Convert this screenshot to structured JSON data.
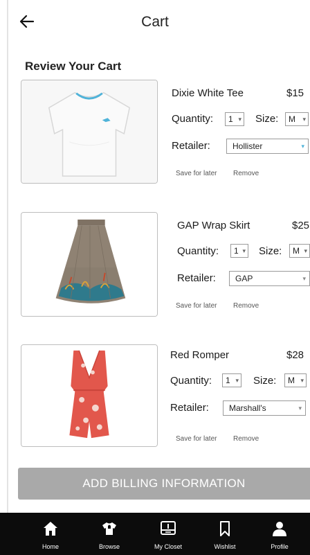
{
  "header": {
    "title": "Cart"
  },
  "section": {
    "heading": "Review Your Cart"
  },
  "items": [
    {
      "name": "Dixie White Tee",
      "price": "$15",
      "quantity_label": "Quantity:",
      "quantity": "1",
      "size_label": "Size:",
      "size": "M",
      "retailer_label": "Retailer:",
      "retailer": "Hollister",
      "save_label": "Save for later",
      "remove_label": "Remove"
    },
    {
      "name": "GAP Wrap Skirt",
      "price": "$25",
      "quantity_label": "Quantity:",
      "quantity": "1",
      "size_label": "Size:",
      "size": "M",
      "retailer_label": "Retailer:",
      "retailer": "GAP",
      "save_label": "Save for later",
      "remove_label": "Remove"
    },
    {
      "name": "Red Romper",
      "price": "$28",
      "quantity_label": "Quantity:",
      "quantity": "1",
      "size_label": "Size:",
      "size": "M",
      "retailer_label": "Retailer:",
      "retailer": "Marshall's",
      "save_label": "Save for later",
      "remove_label": "Remove"
    }
  ],
  "actions": {
    "billing_label": "ADD BILLING INFORMATION"
  },
  "tabbar": {
    "tabs": [
      {
        "label": "Home",
        "icon": "home-icon"
      },
      {
        "label": "Browse",
        "icon": "shirt-icon"
      },
      {
        "label": "My Closet",
        "icon": "closet-icon"
      },
      {
        "label": "Wishlist",
        "icon": "bookmark-icon"
      },
      {
        "label": "Profile",
        "icon": "profile-icon"
      }
    ]
  },
  "colors": {
    "tabbar_bg": "#0c0c0c",
    "button_disabled": "#a9a9a9",
    "tee_logo": "#4fb3d9",
    "romper": "#e2574c"
  }
}
